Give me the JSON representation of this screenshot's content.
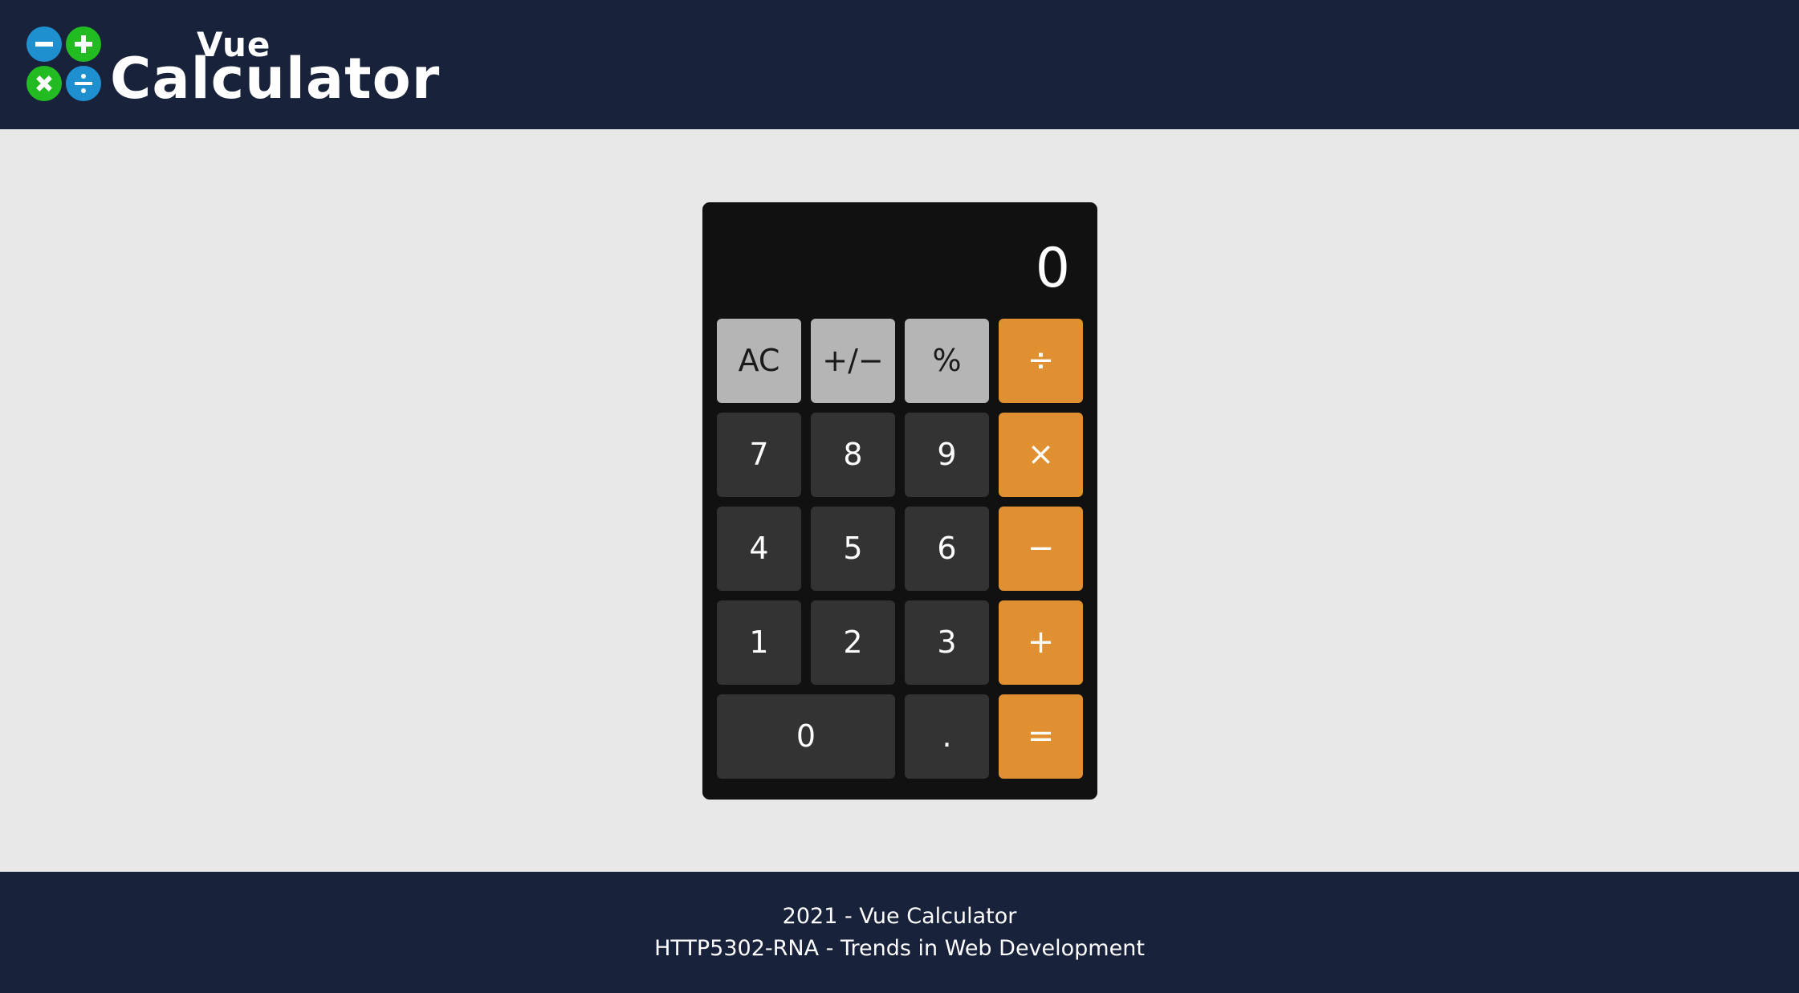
{
  "header": {
    "logo": {
      "title_small": "Vue",
      "title_large": "Calculator",
      "icons": [
        {
          "name": "minus-icon",
          "color": "#1e90d0"
        },
        {
          "name": "plus-icon",
          "color": "#22bb22"
        },
        {
          "name": "times-icon",
          "color": "#22bb22"
        },
        {
          "name": "divide-icon",
          "color": "#1e90d0"
        }
      ]
    }
  },
  "calculator": {
    "display": "0",
    "keys": {
      "clear": "AC",
      "sign": "+/−",
      "percent": "%",
      "divide": "÷",
      "seven": "7",
      "eight": "8",
      "nine": "9",
      "multiply": "×",
      "four": "4",
      "five": "5",
      "six": "6",
      "subtract": "−",
      "one": "1",
      "two": "2",
      "three": "3",
      "add": "+",
      "zero": "0",
      "decimal": ".",
      "equals": "="
    }
  },
  "footer": {
    "line1": "2021 - Vue Calculator",
    "line2": "HTTP5302-RNA - Trends in Web Development"
  },
  "colors": {
    "header_bg": "#19223b",
    "page_bg": "#e8e8e8",
    "calculator_bg": "#111111",
    "function_key": "#b5b5b5",
    "number_key": "#333333",
    "operator_key": "#e09030"
  }
}
